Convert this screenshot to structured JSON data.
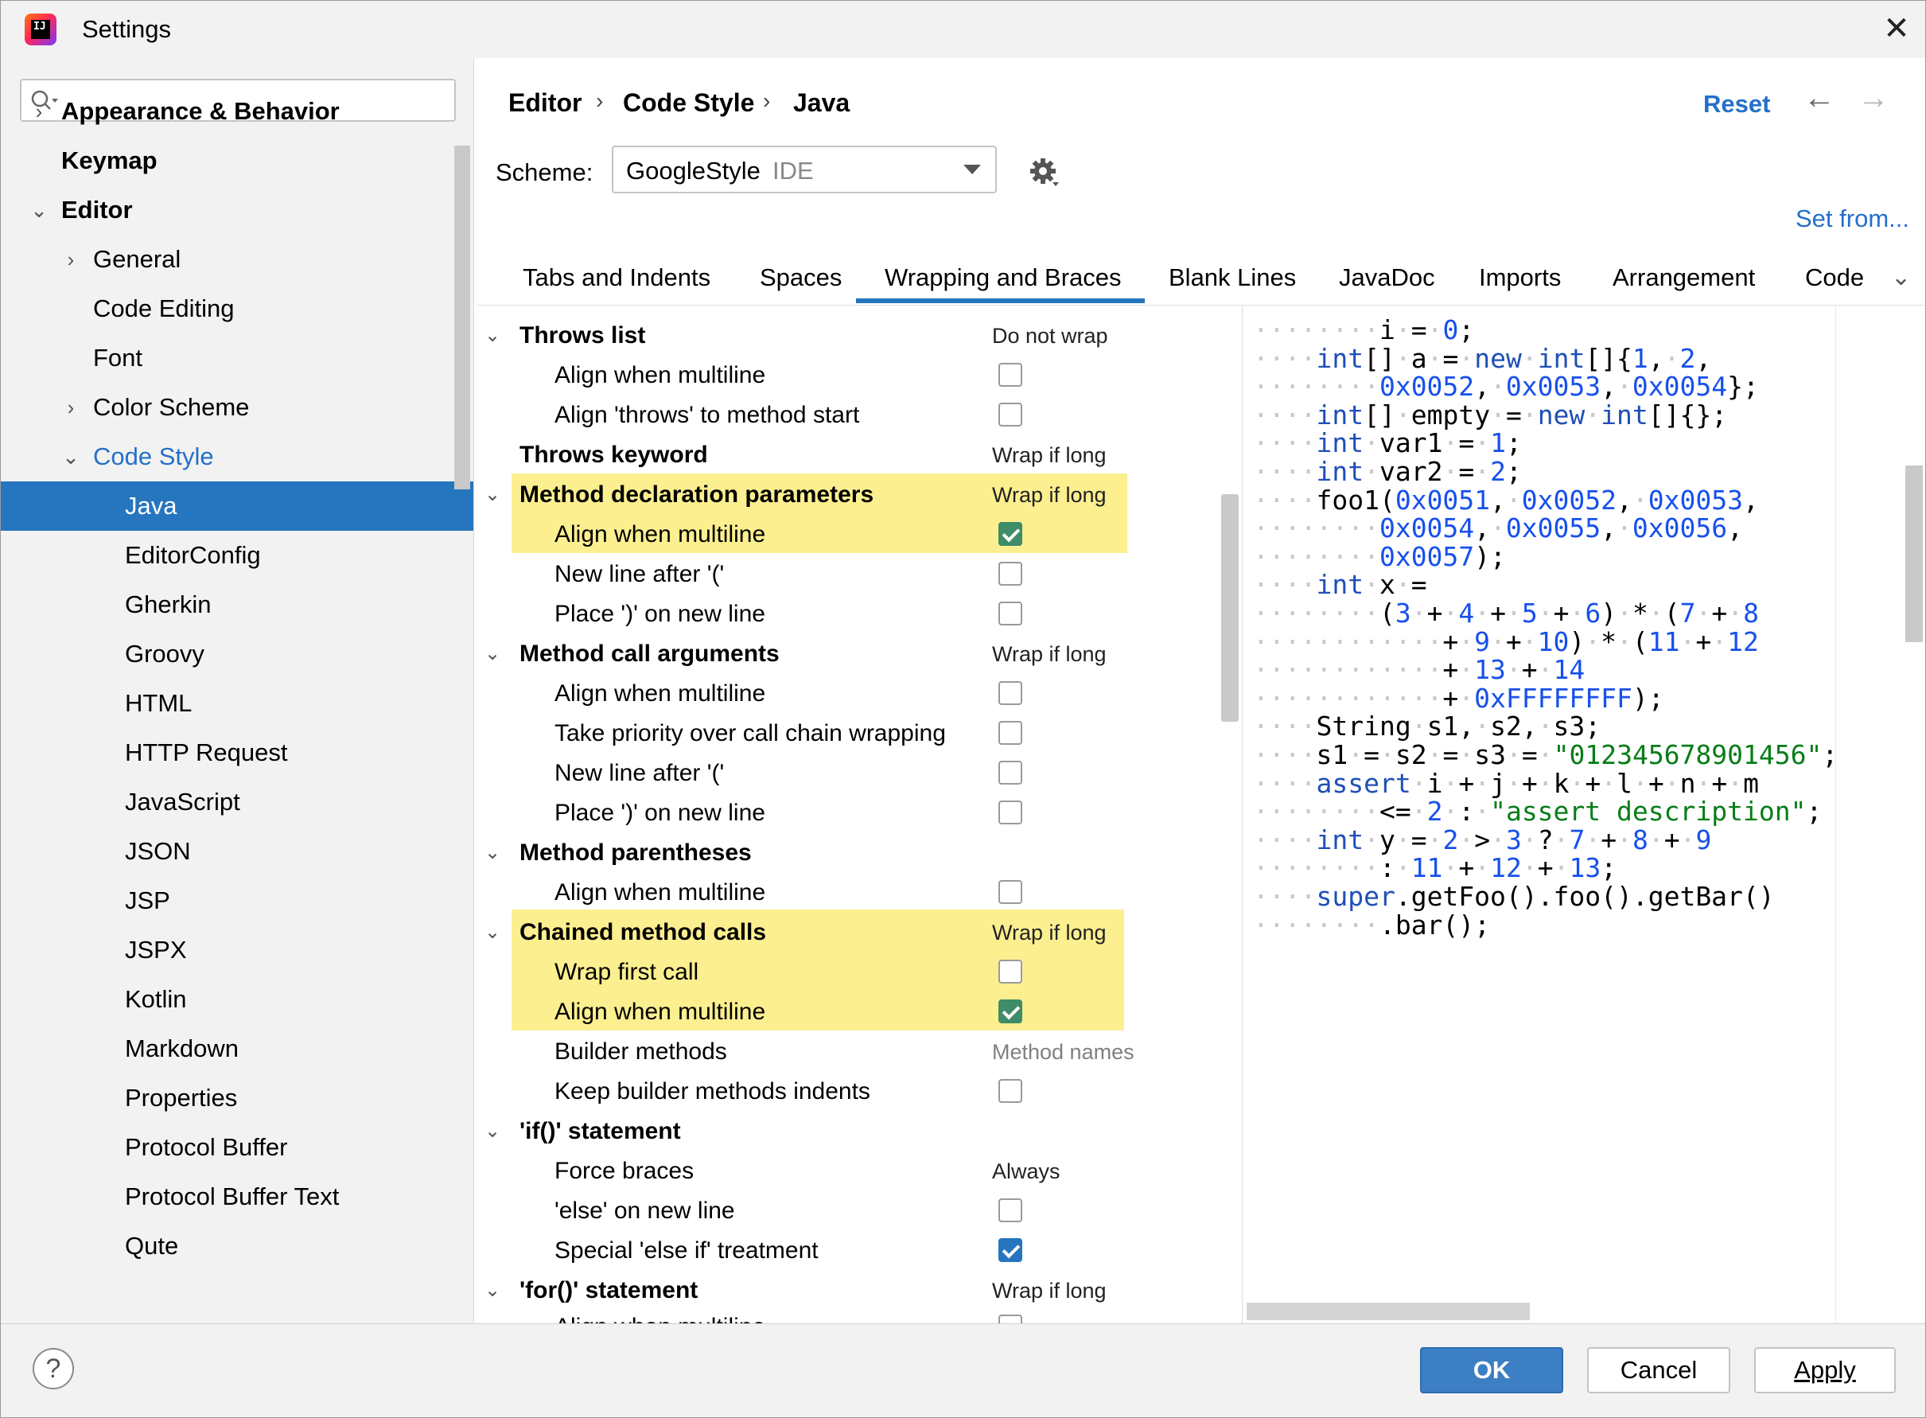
{
  "window": {
    "title": "Settings",
    "app_icon_text": "IJ"
  },
  "search": {
    "value": "",
    "placeholder": ""
  },
  "sidebar": {
    "items": [
      {
        "label": "Appearance & Behavior"
      },
      {
        "label": "Keymap"
      },
      {
        "label": "Editor"
      },
      {
        "label": "General"
      },
      {
        "label": "Code Editing"
      },
      {
        "label": "Font"
      },
      {
        "label": "Color Scheme"
      },
      {
        "label": "Code Style"
      },
      {
        "label": "Java"
      },
      {
        "label": "EditorConfig"
      },
      {
        "label": "Gherkin"
      },
      {
        "label": "Groovy"
      },
      {
        "label": "HTML"
      },
      {
        "label": "HTTP Request"
      },
      {
        "label": "JavaScript"
      },
      {
        "label": "JSON"
      },
      {
        "label": "JSP"
      },
      {
        "label": "JSPX"
      },
      {
        "label": "Kotlin"
      },
      {
        "label": "Markdown"
      },
      {
        "label": "Properties"
      },
      {
        "label": "Protocol Buffer"
      },
      {
        "label": "Protocol Buffer Text"
      },
      {
        "label": "Qute"
      }
    ]
  },
  "breadcrumb": [
    "Editor",
    "Code Style",
    "Java"
  ],
  "header": {
    "reset": "Reset",
    "back_arrow": "←",
    "forward_arrow": "→"
  },
  "scheme": {
    "label": "Scheme:",
    "value": "GoogleStyle",
    "type": "IDE"
  },
  "set_from": "Set from...",
  "tabs": [
    "Tabs and Indents",
    "Spaces",
    "Wrapping and Braces",
    "Blank Lines",
    "JavaDoc",
    "Imports",
    "Arrangement",
    "Code"
  ],
  "active_tab": "Wrapping and Braces",
  "options": [
    {
      "label": "Throws list",
      "value": "Do not wrap"
    },
    {
      "label": "Align when multiline",
      "checked": false
    },
    {
      "label": "Align 'throws' to method start",
      "checked": false
    },
    {
      "label": "Throws keyword",
      "value": "Wrap if long"
    },
    {
      "label": "Method declaration parameters",
      "value": "Wrap if long"
    },
    {
      "label": "Align when multiline",
      "checked": true
    },
    {
      "label": "New line after '('",
      "checked": false
    },
    {
      "label": "Place ')' on new line",
      "checked": false
    },
    {
      "label": "Method call arguments",
      "value": "Wrap if long"
    },
    {
      "label": "Align when multiline",
      "checked": false
    },
    {
      "label": "Take priority over call chain wrapping",
      "checked": false
    },
    {
      "label": "New line after '('",
      "checked": false
    },
    {
      "label": "Place ')' on new line",
      "checked": false
    },
    {
      "label": "Method parentheses"
    },
    {
      "label": "Align when multiline",
      "checked": false
    },
    {
      "label": "Chained method calls",
      "value": "Wrap if long"
    },
    {
      "label": "Wrap first call",
      "checked": false
    },
    {
      "label": "Align when multiline",
      "checked": true
    },
    {
      "label": "Builder methods",
      "value": "Method names"
    },
    {
      "label": "Keep builder methods indents",
      "checked": false
    },
    {
      "label": "'if()' statement"
    },
    {
      "label": "Force braces",
      "value": "Always"
    },
    {
      "label": "'else' on new line",
      "checked": false
    },
    {
      "label": "Special 'else if' treatment",
      "checked": true
    },
    {
      "label": "'for()' statement",
      "value": "Wrap if long"
    },
    {
      "label": "Align when multiline",
      "checked": false
    }
  ],
  "code_preview": [
    "i = 0;",
    "int[] a = new int[]{1, 2,",
    "0x0052, 0x0053, 0x0054};",
    "int[] empty = new int[]{};",
    "int var1 = 1;",
    "int var2 = 2;",
    "foo1(0x0051, 0x0052, 0x0053,",
    "0x0054, 0x0055, 0x0056,",
    "0x0057);",
    "int x =",
    "(3 + 4 + 5 + 6) * (7 + 8",
    "+ 9 + 10) * (11 + 12",
    "+ 13 + 14",
    "+ 0xFFFFFFFF);",
    "String s1, s2, s3;",
    "s1 = s2 = s3 = \"012345678901456\";",
    "assert i + j + k + l + n + m",
    "<= 2 : \"assert description\";",
    "int y = 2 > 3 ? 7 + 8 + 9",
    ": 11 + 12 + 13;",
    "super.getFoo().foo().getBar()",
    ".bar();"
  ],
  "footer": {
    "help": "?",
    "ok": "OK",
    "cancel": "Cancel",
    "apply": "Apply"
  },
  "colors": {
    "accent": "#2675bf",
    "highlight": "#fcef8f",
    "keyword": "#1f4fb8",
    "string": "#067d17"
  }
}
